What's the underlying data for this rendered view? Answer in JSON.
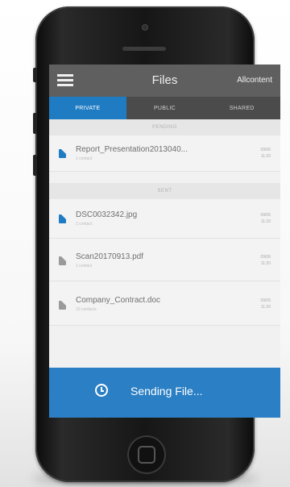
{
  "app": {
    "title": "Files",
    "action_label": "Allcontent"
  },
  "tabs": [
    {
      "label": "PRIVATE",
      "active": true
    },
    {
      "label": "PUBLIC",
      "active": false
    },
    {
      "label": "SHARED",
      "active": false
    }
  ],
  "sections": {
    "pending": "PENDING",
    "sent": "SENT"
  },
  "files": [
    {
      "name": "Report_Presentation2013040...",
      "sub": "1 contact",
      "date_line1": "09/06",
      "date_line2": "11:20",
      "icon": "file-icon-blue"
    },
    {
      "name": "DSC0032342.jpg",
      "sub": "1 contact",
      "date_line1": "09/06",
      "date_line2": "11:20",
      "icon": "file-icon-blue"
    },
    {
      "name": "Scan20170913.pdf",
      "sub": "1 contact",
      "date_line1": "09/06",
      "date_line2": "11:20",
      "icon": "file-icon-gray"
    },
    {
      "name": "Company_Contract.doc",
      "sub": "10 contacts",
      "date_line1": "09/06",
      "date_line2": "11:20",
      "icon": "file-icon-gray"
    }
  ],
  "status": {
    "label": "Sending File...",
    "icon": "clock-icon"
  },
  "colors": {
    "accent": "#1f7cc3",
    "appbar": "#5f5f5f",
    "tabbar": "#4b4b4b",
    "status_bar": "#2b7fc4"
  }
}
